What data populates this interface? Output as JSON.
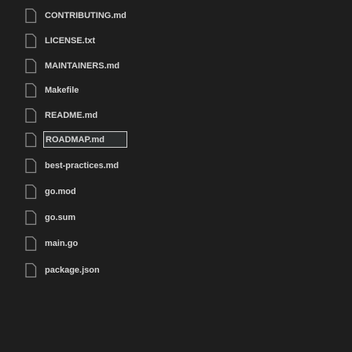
{
  "files": [
    {
      "name": "CONTRIBUTING.md",
      "icon": "file-icon"
    },
    {
      "name": "LICENSE.txt",
      "icon": "file-icon"
    },
    {
      "name": "MAINTAINERS.md",
      "icon": "file-icon"
    },
    {
      "name": "Makefile",
      "icon": "file-icon"
    },
    {
      "name": "README.md",
      "icon": "file-icon"
    },
    {
      "name": "ROADMAP.md",
      "icon": "file-icon",
      "selected": true
    },
    {
      "name": "best-practices.md",
      "icon": "file-icon"
    },
    {
      "name": "go.mod",
      "icon": "file-icon"
    },
    {
      "name": "go.sum",
      "icon": "file-icon"
    },
    {
      "name": "main.go",
      "icon": "file-icon"
    },
    {
      "name": "package.json",
      "icon": "file-icon"
    }
  ],
  "colors": {
    "background": "#1e1e1e",
    "text": "#d4d4d4",
    "icon_stroke": "#8a8a8a",
    "selection_border": "#cfcfcf"
  }
}
